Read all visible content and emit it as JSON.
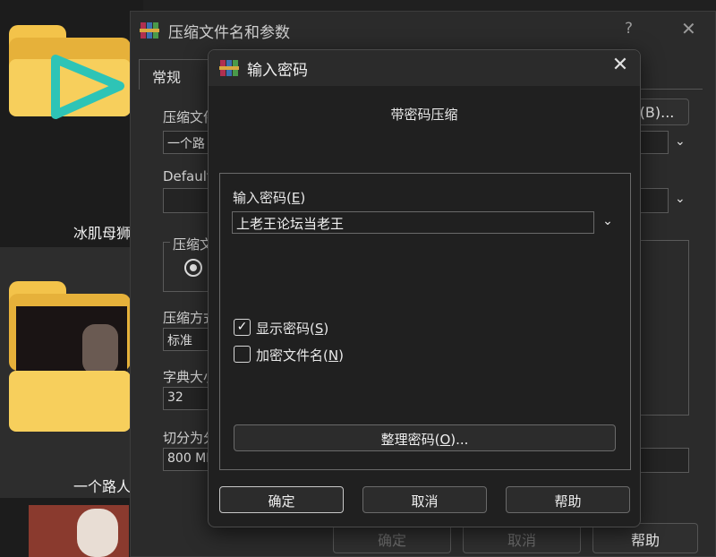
{
  "explorer": {
    "item1_name": "冰肌母狮",
    "item2_name": "一个路人"
  },
  "parent": {
    "title": "压缩文件名和参数",
    "help_icon": "?",
    "close_icon": "✕",
    "tab_general": "常规",
    "browse_button": "(B)...",
    "archive_name_label": "压缩文件",
    "archive_name_value": "一个路",
    "default_label": "Default",
    "format_group_label": "压缩文",
    "method_label": "压缩方式",
    "method_value": "标准",
    "dict_label": "字典大小",
    "dict_value": "32",
    "split_label": "切分为分",
    "split_value": "800 ME",
    "ok_button": "确定",
    "cancel_button": "取消",
    "help_button": "帮助"
  },
  "dialog": {
    "title": "输入密码",
    "close_icon": "✕",
    "heading": "带密码压缩",
    "password_label": "输入密码",
    "password_hotkey": "E",
    "password_value": "上老王论坛当老王",
    "dropdown_icon": "⌄",
    "show_password_label": "显示密码",
    "show_password_hotkey": "S",
    "show_password_checked": true,
    "encrypt_names_label": "加密文件名",
    "encrypt_names_hotkey": "N",
    "encrypt_names_checked": false,
    "manage_button": "整理密码",
    "manage_hotkey": "O",
    "manage_suffix": "...",
    "ok_button": "确定",
    "cancel_button": "取消",
    "help_button": "帮助",
    "checkmark": "✓"
  },
  "colors": {
    "folder": "#f7cf5c",
    "teal_play": "#2ec4b6"
  }
}
